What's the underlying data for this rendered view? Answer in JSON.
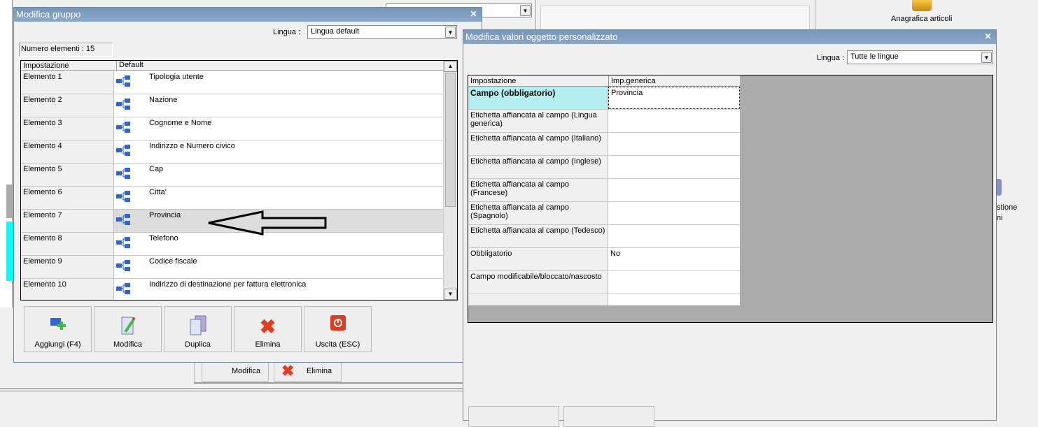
{
  "background": {
    "desktop_icon_label": "Anagrafica articoli",
    "right_partial_text": [
      "stione",
      "ni"
    ],
    "behind_buttons": [
      "Modifica",
      "Elimina"
    ]
  },
  "group_window": {
    "title": "Modifica gruppo",
    "lingua_label": "Lingua :",
    "lingua_value": "Lingua default",
    "count_label": "Numero elementi : 15",
    "columns": [
      "Impostazione",
      "Default"
    ],
    "rows": [
      {
        "name": "Elemento 1",
        "value": "Tipologia utente"
      },
      {
        "name": "Elemento 2",
        "value": "Nazione"
      },
      {
        "name": "Elemento 3",
        "value": "Cognome e Nome"
      },
      {
        "name": "Elemento 4",
        "value": "Indirizzo e Numero civico"
      },
      {
        "name": "Elemento 5",
        "value": "Cap"
      },
      {
        "name": "Elemento 6",
        "value": "Citta'"
      },
      {
        "name": "Elemento 7",
        "value": "Provincia"
      },
      {
        "name": "Elemento 8",
        "value": "Telefono"
      },
      {
        "name": "Elemento 9",
        "value": "Codice fiscale"
      },
      {
        "name": "Elemento 10",
        "value": "Indirizzo di destinazione per fattura elettronica"
      }
    ],
    "buttons": [
      "Aggiungi (F4)",
      "Modifica",
      "Duplica",
      "Elimina",
      "Uscita (ESC)"
    ]
  },
  "custom_window": {
    "title": "Modifica valori oggetto personalizzato",
    "lingua_label": "Lingua :",
    "lingua_value": "Tutte le lingue",
    "columns": [
      "Impostazione",
      "Imp.generica"
    ],
    "rows": [
      {
        "name": "Campo (obbligatorio)",
        "value": "Provincia"
      },
      {
        "name": "Etichetta affiancata al campo (Lingua generica)",
        "value": ""
      },
      {
        "name": "Etichetta affiancata al campo (Italiano)",
        "value": ""
      },
      {
        "name": "Etichetta affiancata al campo (Inglese)",
        "value": ""
      },
      {
        "name": "Etichetta affiancata al campo (Francese)",
        "value": ""
      },
      {
        "name": "Etichetta affiancata al campo (Spagnolo)",
        "value": ""
      },
      {
        "name": "Etichetta affiancata al campo (Tedesco)",
        "value": ""
      },
      {
        "name": "Obbligatorio",
        "value": "No"
      },
      {
        "name": "Campo modificabile/bloccato/nascosto",
        "value": ""
      }
    ]
  }
}
